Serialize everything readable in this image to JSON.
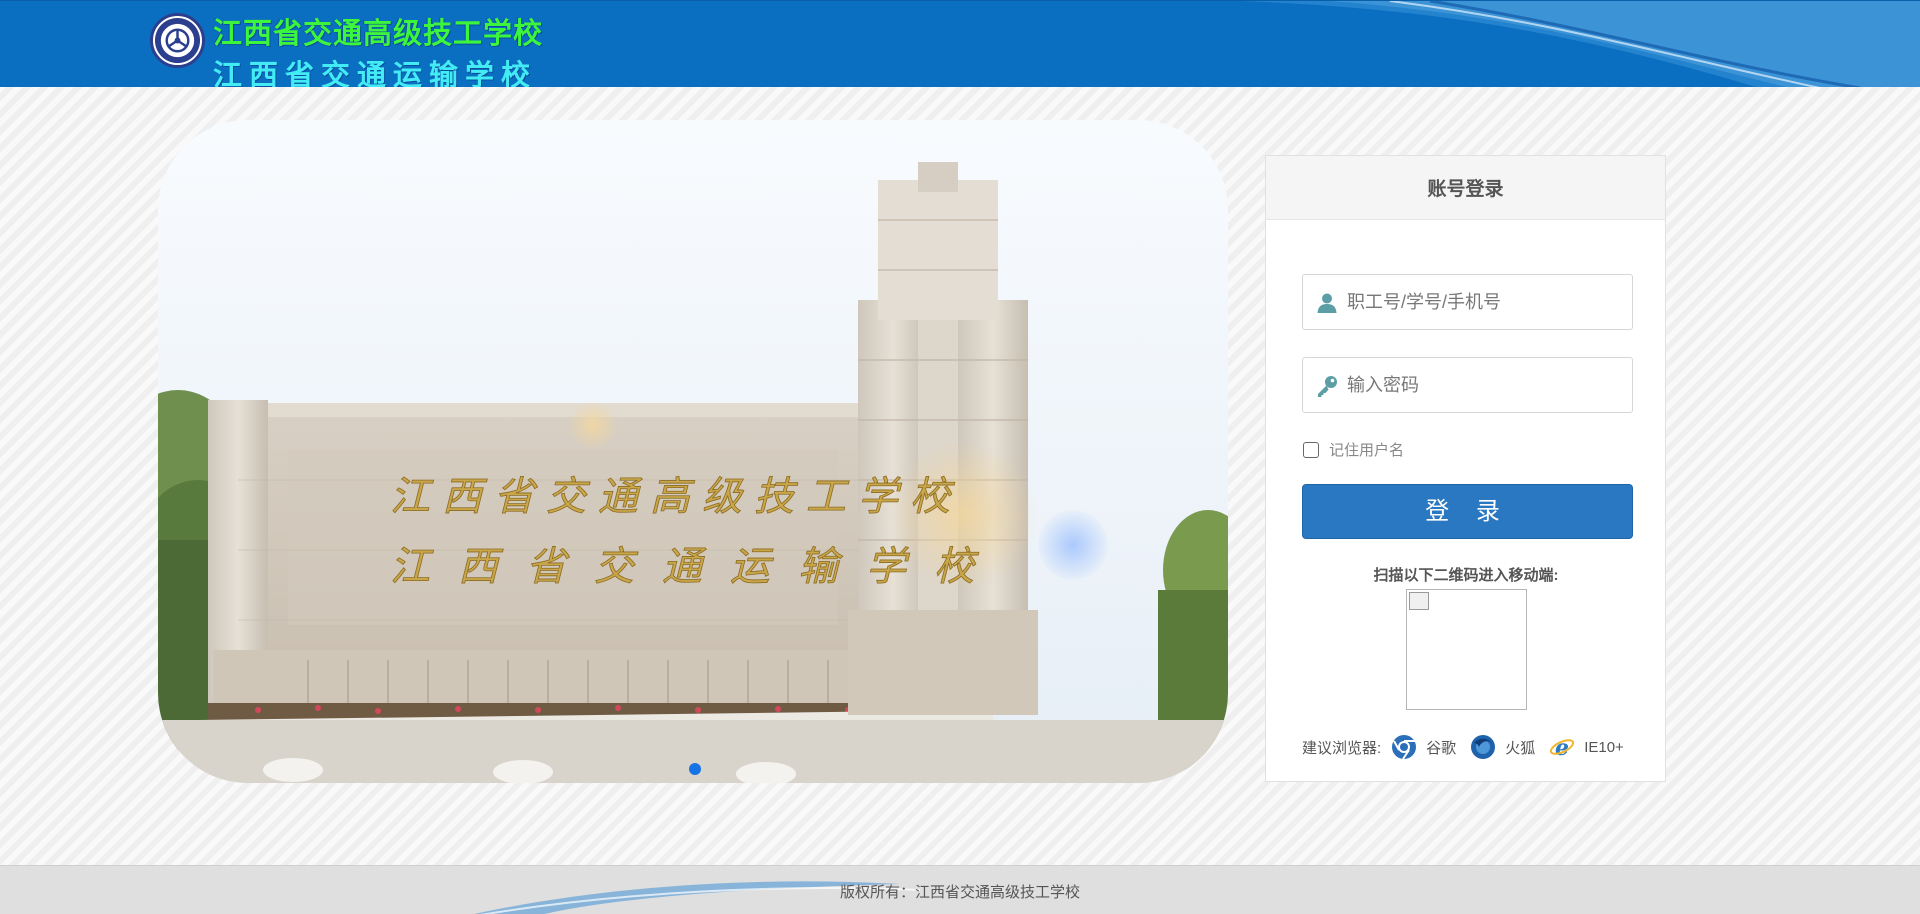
{
  "header": {
    "school_name_primary": "江西省交通高级技工学校",
    "school_name_secondary": "江西省交通运输学校",
    "logo_icon": "school-seal-icon",
    "background_color": "#0b6fc1"
  },
  "banner": {
    "image": "campus-gate-photo",
    "inscription_line_1": "江西省交通高级技工学校",
    "inscription_line_2": "江西省交通运输学校",
    "active_slide": 1,
    "slide_count": 1
  },
  "login": {
    "title": "账号登录",
    "username_placeholder": "职工号/学号/手机号",
    "username_value": "",
    "username_icon": "user-icon",
    "password_placeholder": "输入密码",
    "password_value": "",
    "password_icon": "key-icon",
    "remember_label": "记住用户名",
    "remember_checked": false,
    "submit_label": "登 录",
    "button_color": "#2a78c1",
    "qr_prompt": "扫描以下二维码进入移动端:",
    "qr_icon": "broken-image-icon",
    "browser_hint_label": "建议浏览器:",
    "browsers": [
      {
        "name": "谷歌",
        "icon": "chrome-icon"
      },
      {
        "name": "火狐",
        "icon": "firefox-icon"
      },
      {
        "name": "IE10+",
        "icon": "ie-icon"
      }
    ]
  },
  "footer": {
    "copyright": "版权所有：江西省交通高级技工学校"
  }
}
